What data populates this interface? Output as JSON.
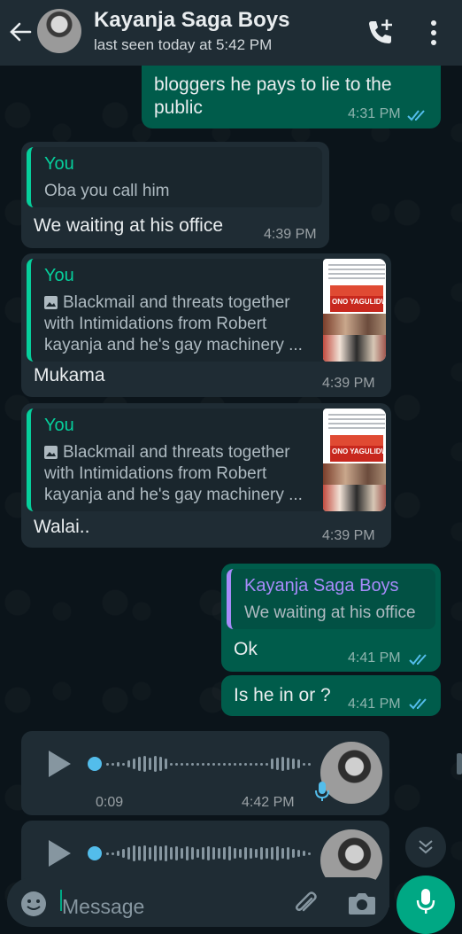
{
  "header": {
    "title": "Kayanja Saga Boys",
    "status": "last seen today at 5:42 PM",
    "icons": [
      "back-arrow-icon",
      "avatar",
      "add-call-icon",
      "more-vert-icon"
    ]
  },
  "messages": [
    {
      "direction": "out",
      "text_line1": "bloggers he pays to lie to the",
      "text_line2": "public",
      "time": "4:31 PM",
      "read": true
    },
    {
      "direction": "in",
      "quote_author": "You",
      "quote_text": "Oba you call him",
      "text": "We waiting at his office",
      "time": "4:39 PM"
    },
    {
      "direction": "in",
      "quote_author": "You",
      "quote_line1": "Blackmail and threats together",
      "quote_line2": "with Intimidations from Robert",
      "quote_line3": "kayanja and he's gay machinery ...",
      "thumb_text": "ONO YAGULIDWA TWABAKOWA!",
      "text": "Mukama",
      "time": "4:39 PM"
    },
    {
      "direction": "in",
      "quote_author": "You",
      "quote_line1": "Blackmail and threats together",
      "quote_line2": "with Intimidations from Robert",
      "quote_line3": "kayanja and he's gay machinery ...",
      "thumb_text": "ONO YAGULIDWA TWABAKOWA!",
      "text": "Walai..",
      "time": "4:39 PM"
    },
    {
      "direction": "out",
      "quote_author": "Kayanja Saga Boys",
      "quote_text": "We waiting at his office",
      "text": "Ok",
      "time": "4:41 PM",
      "read": true
    },
    {
      "direction": "out",
      "text": "Is he in or ?",
      "time": "4:41 PM",
      "read": true
    },
    {
      "direction": "in",
      "type": "voice",
      "duration": "0:09",
      "time": "4:42 PM"
    },
    {
      "direction": "in",
      "type": "voice"
    }
  ],
  "input": {
    "placeholder": "Message"
  },
  "colors": {
    "background": "#0b141a",
    "header": "#1f2c34",
    "outgoing": "#005c4b",
    "incoming": "#1f2c34",
    "accent": "#00a884",
    "read_tick": "#53bdeb",
    "quote_you": "#06cf9c",
    "quote_contact": "#a78bfa"
  }
}
